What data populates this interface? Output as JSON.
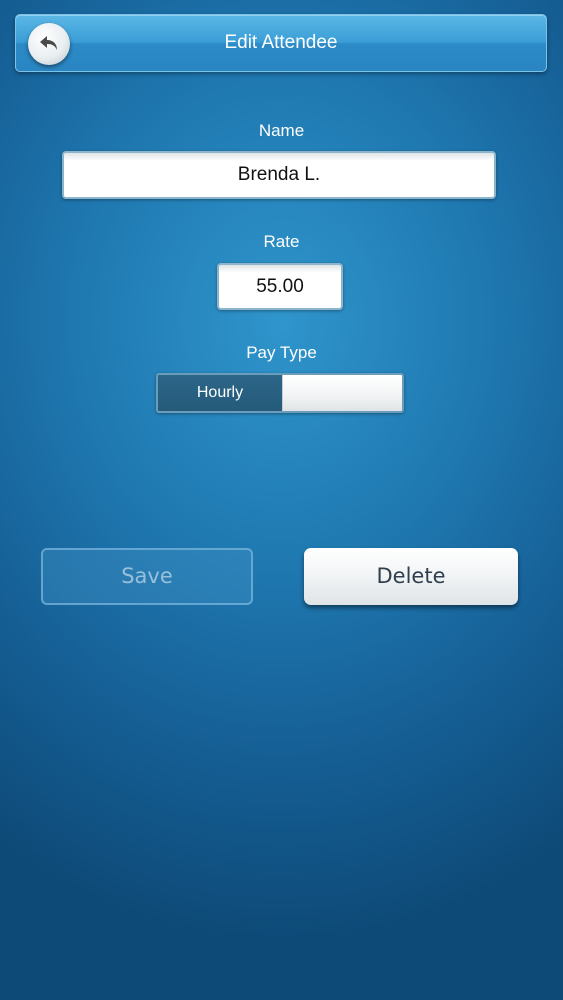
{
  "header": {
    "title": "Edit Attendee",
    "back_icon": "back-arrow-icon"
  },
  "form": {
    "name_label": "Name",
    "name_value": "Brenda L.",
    "rate_label": "Rate",
    "rate_value": "55.00",
    "pay_type_label": "Pay Type",
    "pay_type_selected": "Hourly"
  },
  "actions": {
    "save_label": "Save",
    "delete_label": "Delete"
  },
  "colors": {
    "header_blue": "#3b9ed6",
    "background_blue": "#1f78b0",
    "toggle_selected": "#255a7a",
    "delete_text": "#2f3f4d"
  }
}
